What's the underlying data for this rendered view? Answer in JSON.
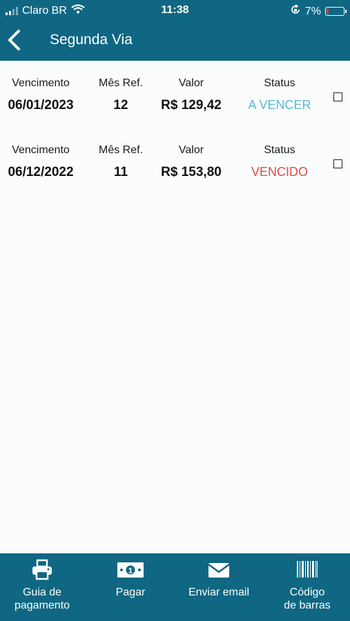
{
  "status_bar": {
    "carrier": "Claro BR",
    "time": "11:38",
    "battery": "7%"
  },
  "header": {
    "title": "Segunda Via"
  },
  "bills": [
    {
      "vencimento_label": "Vencimento",
      "mes_label": "Mês Ref.",
      "valor_label": "Valor",
      "status_label": "Status",
      "vencimento": "06/01/2023",
      "mes": "12",
      "valor": "R$ 129,42",
      "status": "A VENCER",
      "status_color": "#5bb8d6",
      "checked": false
    },
    {
      "vencimento_label": "Vencimento",
      "mes_label": "Mês Ref.",
      "valor_label": "Valor",
      "status_label": "Status",
      "vencimento": "06/12/2022",
      "mes": "11",
      "valor": "R$ 153,80",
      "status": "VENCIDO",
      "status_color": "#e04848",
      "checked": false
    }
  ],
  "bottom_bar": {
    "guia": {
      "line1": "Guia de",
      "line2": "pagamento",
      "icon": "printer-icon"
    },
    "pagar": {
      "label": "Pagar",
      "icon": "money-icon"
    },
    "email": {
      "label": "Enviar email",
      "icon": "envelope-icon"
    },
    "codigo": {
      "line1": "Código",
      "line2": "de barras",
      "icon": "barcode-icon"
    }
  },
  "colors": {
    "primary": "#0f6783",
    "due_soon": "#5bb8d6",
    "overdue": "#e04848"
  }
}
